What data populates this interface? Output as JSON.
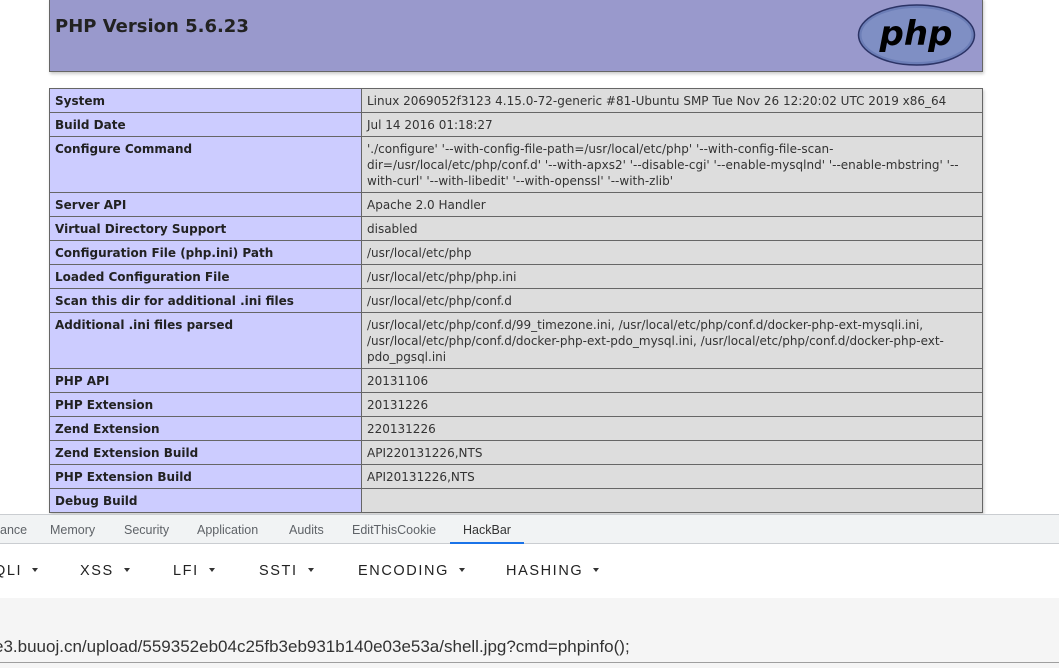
{
  "phpinfo": {
    "title": "PHP Version 5.6.23",
    "logo_text": "php",
    "rows": [
      {
        "label": "System",
        "value": "Linux 2069052f3123 4.15.0-72-generic #81-Ubuntu SMP Tue Nov 26 12:20:02 UTC 2019 x86_64"
      },
      {
        "label": "Build Date",
        "value": "Jul 14 2016 01:18:27"
      },
      {
        "label": "Configure Command",
        "value": "'./configure' '--with-config-file-path=/usr/local/etc/php' '--with-config-file-scan-dir=/usr/local/etc/php/conf.d' '--with-apxs2' '--disable-cgi' '--enable-mysqlnd' '--enable-mbstring' '--with-curl' '--with-libedit' '--with-openssl' '--with-zlib'"
      },
      {
        "label": "Server API",
        "value": "Apache 2.0 Handler"
      },
      {
        "label": "Virtual Directory Support",
        "value": "disabled"
      },
      {
        "label": "Configuration File (php.ini) Path",
        "value": "/usr/local/etc/php"
      },
      {
        "label": "Loaded Configuration File",
        "value": "/usr/local/etc/php/php.ini"
      },
      {
        "label": "Scan this dir for additional .ini files",
        "value": "/usr/local/etc/php/conf.d"
      },
      {
        "label": "Additional .ini files parsed",
        "value": "/usr/local/etc/php/conf.d/99_timezone.ini, /usr/local/etc/php/conf.d/docker-php-ext-mysqli.ini, /usr/local/etc/php/conf.d/docker-php-ext-pdo_mysql.ini, /usr/local/etc/php/conf.d/docker-php-ext-pdo_pgsql.ini"
      },
      {
        "label": "PHP API",
        "value": "20131106"
      },
      {
        "label": "PHP Extension",
        "value": "20131226"
      },
      {
        "label": "Zend Extension",
        "value": "220131226"
      },
      {
        "label": "Zend Extension Build",
        "value": "API220131226,NTS"
      },
      {
        "label": "PHP Extension Build",
        "value": "API20131226,NTS"
      },
      {
        "label": "Debug Build",
        "value": ""
      }
    ]
  },
  "devtools": {
    "tabs": [
      {
        "label": "ance",
        "active": false
      },
      {
        "label": "Memory",
        "active": false
      },
      {
        "label": "Security",
        "active": false
      },
      {
        "label": "Application",
        "active": false
      },
      {
        "label": "Audits",
        "active": false
      },
      {
        "label": "EditThisCookie",
        "active": false
      },
      {
        "label": "HackBar",
        "active": true
      }
    ],
    "accent_color": "#1a73e8"
  },
  "hackbar": {
    "menus": [
      "QLI",
      "XSS",
      "LFI",
      "SSTI",
      "ENCODING",
      "HASHING"
    ],
    "menu_icon": "chevron-down-icon",
    "url_value": "e3.buuoj.cn/upload/559352eb04c25fb3eb931b140e03e53a/shell.jpg?cmd=phpinfo();"
  },
  "colors": {
    "header_bg": "#9999cc",
    "label_bg": "#ccccff",
    "value_bg": "#dddddd"
  }
}
